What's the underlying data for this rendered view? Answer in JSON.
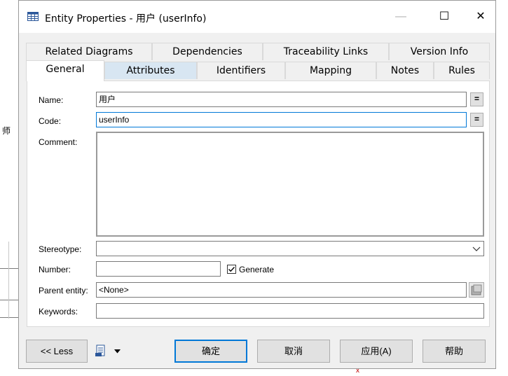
{
  "window": {
    "title": "Entity Properties - 用户 (userInfo)",
    "minimize_label": "—",
    "maximize_label": "☐",
    "close_label": "✕"
  },
  "tabs_back": [
    {
      "label": "Related Diagrams"
    },
    {
      "label": "Dependencies"
    },
    {
      "label": "Traceability Links"
    },
    {
      "label": "Version Info"
    }
  ],
  "tabs_front": [
    {
      "label": "General",
      "selected": true
    },
    {
      "label": "Attributes",
      "hover": true
    },
    {
      "label": "Identifiers"
    },
    {
      "label": "Mapping"
    },
    {
      "label": "Notes"
    },
    {
      "label": "Rules"
    }
  ],
  "form": {
    "name_label": "Name:",
    "name_value": "用户",
    "code_label": "Code:",
    "code_value": "userInfo",
    "comment_label": "Comment:",
    "comment_value": "",
    "stereotype_label": "Stereotype:",
    "stereotype_value": "",
    "number_label": "Number:",
    "number_value": "",
    "generate_label": "Generate",
    "generate_checked": true,
    "parent_entity_label": "Parent entity:",
    "parent_entity_value": "<None>",
    "keywords_label": "Keywords:",
    "keywords_value": "",
    "equals_label": "="
  },
  "footer": {
    "less_label": "<< Less",
    "ok_label": "确定",
    "cancel_label": "取消",
    "apply_label": "应用(A)",
    "help_label": "帮助"
  },
  "background": {
    "left_char": "师",
    "bottom_char": "x"
  }
}
